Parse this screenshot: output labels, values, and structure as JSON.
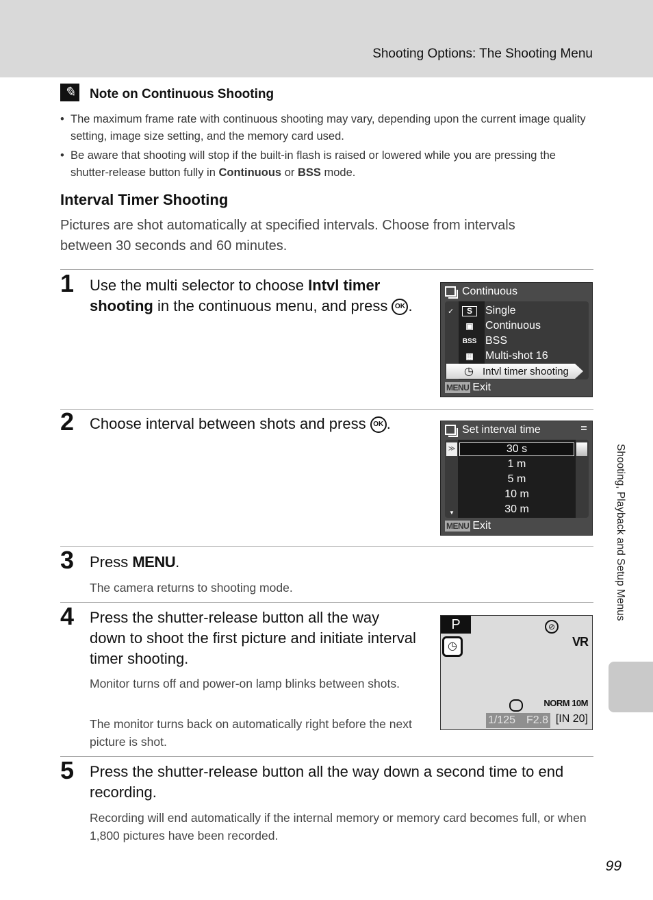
{
  "header": {
    "title": "Shooting Options: The Shooting Menu"
  },
  "note": {
    "icon": "pencil-note-icon",
    "title": "Note on Continuous Shooting",
    "bullets": [
      "The maximum frame rate with continuous shooting may vary, depending upon the current image quality setting, image size setting, and the memory card used.",
      {
        "pre": "Be aware that shooting will stop if the built-in flash is raised or lowered while you are pressing the shutter-release button fully in ",
        "b1": "Continuous",
        "mid": " or ",
        "b2": "BSS",
        "post": " mode."
      }
    ]
  },
  "section": {
    "title": "Interval Timer Shooting",
    "intro": "Pictures are shot automatically at specified intervals. Choose from intervals between 30 seconds and 60 minutes."
  },
  "steps": [
    {
      "num": "1",
      "pre": "Use the multi selector to choose ",
      "bold": "Intvl timer shooting",
      "post": " in the continuous menu, and press ",
      "button": "OK",
      "end": "."
    },
    {
      "num": "2",
      "pre": "Choose interval between shots and press ",
      "button": "OK",
      "end": "."
    },
    {
      "num": "3",
      "pre": "Press ",
      "button": "MENU",
      "end": ".",
      "sub": "The camera returns to shooting mode."
    },
    {
      "num": "4",
      "text": "Press the shutter-release button all the way down to shoot the first picture and initiate interval timer shooting.",
      "subs": [
        "Monitor turns off and power-on lamp blinks between shots.",
        "The monitor turns back on automatically right before the next picture is shot."
      ]
    },
    {
      "num": "5",
      "text": "Press the shutter-release button all the way down a second time to end recording.",
      "sub": "Recording will end automatically if the internal memory or memory card becomes full, or when 1,800 pictures have been recorded."
    }
  ],
  "screen1": {
    "title": "Continuous",
    "items": [
      {
        "icon": "S",
        "label": "Single",
        "checked": true
      },
      {
        "icon": "▣",
        "label": "Continuous"
      },
      {
        "icon": "BSS",
        "label": "BSS"
      },
      {
        "icon": "▦",
        "label": "Multi-shot 16"
      }
    ],
    "selected": {
      "icon": "◷",
      "label": "Intvl timer shooting"
    },
    "menu_tag": "MENU",
    "exit": "Exit"
  },
  "screen2": {
    "title": "Set interval time",
    "options": [
      "30 s",
      "1 m",
      "5 m",
      "10 m",
      "30 m"
    ],
    "selected_index": 0,
    "menu_tag": "MENU",
    "exit": "Exit"
  },
  "viewfinder": {
    "mode": "P",
    "timer_icon": "◷",
    "flash_icon": "⊘",
    "vr": "VR",
    "quality": "NORM 10M",
    "shutter": "1/125",
    "aperture": "F2.8",
    "count": "[IN 20]"
  },
  "side_label": "Shooting, Playback and Setup Menus",
  "page_number": "99"
}
